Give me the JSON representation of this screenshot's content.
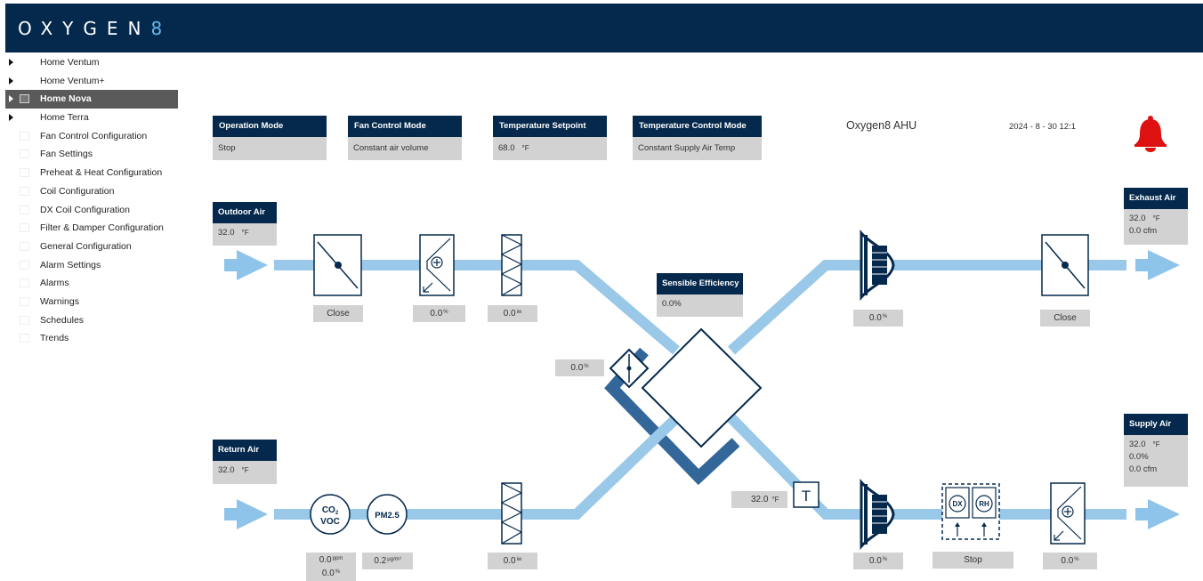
{
  "header": {
    "logo_main": "OXYGEN",
    "logo_accent": "8"
  },
  "sidebar": {
    "items": [
      {
        "label": "Home Ventum",
        "expandable": true,
        "active": false
      },
      {
        "label": "Home Ventum+",
        "expandable": true,
        "active": false
      },
      {
        "label": "Home Nova",
        "expandable": true,
        "active": true
      },
      {
        "label": "Home Terra",
        "expandable": true,
        "active": false
      },
      {
        "label": "Fan Control Configuration"
      },
      {
        "label": "Fan Settings"
      },
      {
        "label": "Preheat & Heat Configuration"
      },
      {
        "label": "Coil Configuration"
      },
      {
        "label": "DX Coil Configuration"
      },
      {
        "label": "Filter & Damper Configuration"
      },
      {
        "label": "General Configuration"
      },
      {
        "label": "Alarm Settings"
      },
      {
        "label": "Alarms"
      },
      {
        "label": "Warnings"
      },
      {
        "label": "Schedules"
      },
      {
        "label": "Trends"
      }
    ]
  },
  "status_cards": {
    "operation_mode": {
      "title": "Operation Mode",
      "value": "Stop"
    },
    "fan_control_mode": {
      "title": "Fan Control Mode",
      "value": "Constant air volume"
    },
    "temperature_setpoint": {
      "title": "Temperature Setpoint",
      "value": "68.0",
      "unit": "°F"
    },
    "temperature_control_mode": {
      "title": "Temperature Control Mode",
      "value": "Constant Supply Air Temp"
    }
  },
  "ahu_title": "Oxygen8 AHU",
  "datetime": "2024 - 8 - 30  12:1",
  "outdoor_air": {
    "title": "Outdoor Air",
    "temp": "32.0",
    "unit": "°F"
  },
  "return_air": {
    "title": "Return Air",
    "temp": "32.0",
    "unit": "°F"
  },
  "exhaust_air": {
    "title": "Exhaust Air",
    "temp": "32.0",
    "unit": "°F",
    "flow": "0.0 cfm"
  },
  "supply_air": {
    "title": "Supply Air",
    "temp": "32.0",
    "unit": "°F",
    "humidity": "0.0%",
    "flow": "0.0 cfm"
  },
  "sensible_efficiency": {
    "title": "Sensible Efficiency",
    "value": "0.0%"
  },
  "outdoor_damper": {
    "status": "Close"
  },
  "exhaust_damper": {
    "status": "Close"
  },
  "preheat_coil": {
    "value": "0.0",
    "unit": "%"
  },
  "outdoor_filter": {
    "value": "0.0",
    "unit": "iw"
  },
  "return_filter": {
    "value": "0.0",
    "unit": "iw"
  },
  "bypass_damper": {
    "value": "0.0",
    "unit": "%"
  },
  "exhaust_fan": {
    "value": "0.0",
    "unit": "%"
  },
  "supply_fan": {
    "value": "0.0",
    "unit": "%"
  },
  "reheat_coil": {
    "value": "0.0",
    "unit": "%"
  },
  "supply_temp_sensor": {
    "value": "32.0",
    "unit": "°F",
    "symbol": "T"
  },
  "co2_voc_sensor": {
    "co2_label": "CO",
    "co2_sub": "2",
    "voc_label": "VOC",
    "co2_value": "0.0",
    "co2_unit": "ppm",
    "voc_value": "0.0",
    "voc_unit": "%"
  },
  "pm25_sensor": {
    "label": "PM2.5",
    "value": "0.2",
    "unit": "µg/m³"
  },
  "dx_rh_unit": {
    "dx_label": "DX",
    "rh_label": "RH",
    "status": "Stop"
  },
  "colors": {
    "navy": "#05294c",
    "duct": "#99c8e8",
    "arrow": "#8fc4ea",
    "bypass": "#336699",
    "bell": "#dd1111",
    "panel": "#d2d2d2"
  },
  "icons": {
    "alarm": "bell-icon"
  }
}
